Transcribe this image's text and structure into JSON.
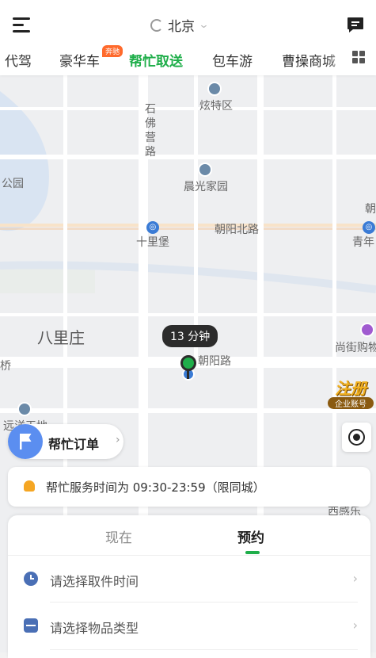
{
  "header": {
    "city": "北京",
    "tabs": [
      {
        "label": "代驾",
        "active": false
      },
      {
        "label": "豪华车",
        "active": false,
        "badge": "奔驰"
      },
      {
        "label": "帮忙取送",
        "active": true
      },
      {
        "label": "包车游",
        "active": false
      },
      {
        "label": "曹操商城",
        "active": false
      }
    ]
  },
  "map": {
    "labels": {
      "xuanteqv": "炫特区",
      "shifoying": "石佛营路",
      "chenguang": "晨光家园",
      "park": "公园",
      "chaoyangbei": "朝阳北路",
      "shilipu": "十里堡",
      "chao": "朝",
      "qingnian": "青年",
      "balizhuang": "八里庄",
      "chaoyanglu": "朝阳路",
      "shangjie": "尚街购物",
      "qiao": "桥",
      "yuanyang": "远洋天地",
      "xiganle": "西感乐"
    },
    "eta": "13 分钟",
    "promo": {
      "main": "注册",
      "sub": "企业账号"
    }
  },
  "order_button": {
    "label": "帮忙订单"
  },
  "notice": {
    "text": "帮忙服务时间为 09:30-23:59（限同城）"
  },
  "panel": {
    "tabs": {
      "now": "现在",
      "book": "预约"
    },
    "rows": {
      "pickup_time": "请选择取件时间",
      "item_type": "请选择物品类型"
    }
  },
  "colors": {
    "accent": "#1fae4a",
    "badge": "#ff6a2c",
    "blue": "#3a7bd5"
  }
}
